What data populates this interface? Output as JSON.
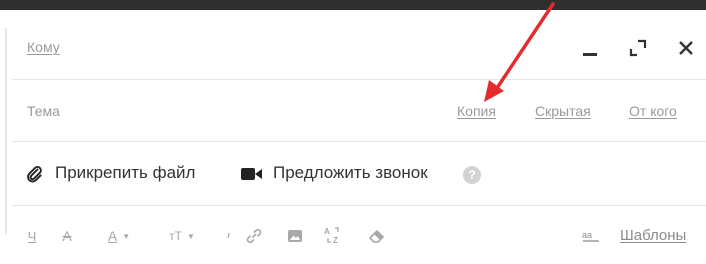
{
  "header": {
    "to_label": "Кому",
    "subject_label": "Тема",
    "cc_label": "Копия",
    "bcc_label": "Скрытая",
    "from_label": "От кого"
  },
  "attach": {
    "attach_label": "Прикрепить файл",
    "call_label": "Предложить звонок",
    "help_symbol": "?"
  },
  "toolbar": {
    "underline_symbol": "Ч",
    "strike_symbol": "А",
    "text_color_symbol": "А",
    "font_size_symbol": "тТ",
    "templates_label": "Шаблоны",
    "icons": [
      "underline-icon",
      "strikethrough-icon",
      "text-color-icon",
      "font-size-icon",
      "link-icon",
      "image-icon",
      "transliterate-icon",
      "clear-format-icon",
      "spellcheck-icon"
    ]
  },
  "window_controls": [
    "minimize-icon",
    "expand-icon",
    "close-icon"
  ],
  "colors": {
    "topbar": "#2f2f2f",
    "link_gray": "#9a9a9a",
    "arrow": "#e52b2b"
  }
}
